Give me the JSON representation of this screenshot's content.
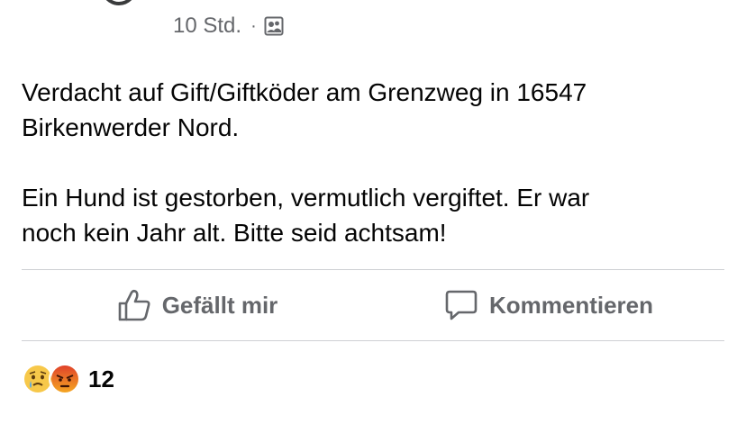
{
  "post": {
    "time": "10 Std.",
    "separator": "·",
    "audience_icon": "group-audience-icon",
    "paragraph_1_line_1": "Verdacht auf Gift/Giftköder am Grenzweg in 16547",
    "paragraph_1_line_2": "Birkenwerder Nord.",
    "paragraph_2_line_1": "Ein Hund ist gestorben,  vermutlich vergiftet. Er war",
    "paragraph_2_line_2": "noch kein Jahr alt. Bitte seid achtsam!"
  },
  "actions": {
    "like_label": "Gefällt mir",
    "like_icon": "thumbs-up-icon",
    "comment_label": "Kommentieren",
    "comment_icon": "speech-bubble-icon"
  },
  "reactions": {
    "icons": [
      "sad-face-icon",
      "angry-face-icon"
    ],
    "count": "12"
  },
  "colors": {
    "secondary_text": "#65676b",
    "divider": "#ced0d4",
    "sad_yellow": "#f7b125",
    "angry_red": "#e9710f"
  }
}
